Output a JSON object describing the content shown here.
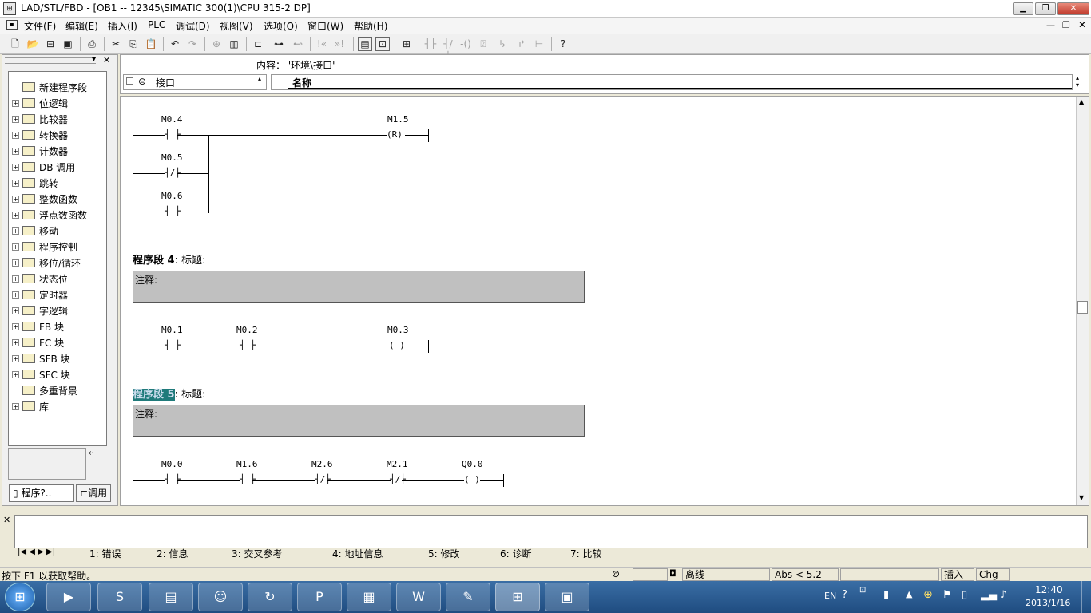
{
  "window": {
    "title": "LAD/STL/FBD  - [OB1 -- 12345\\SIMATIC 300(1)\\CPU 315-2 DP]"
  },
  "menu": [
    "文件(F)",
    "编辑(E)",
    "插入(I)",
    "PLC",
    "调试(D)",
    "视图(V)",
    "选项(O)",
    "窗口(W)",
    "帮助(H)"
  ],
  "tree": [
    {
      "label": "新建程序段",
      "icon": "new-network-icon",
      "expand": false
    },
    {
      "label": "位逻辑",
      "icon": "bit-logic-icon",
      "expand": true
    },
    {
      "label": "比较器",
      "icon": "comparator-icon",
      "expand": true
    },
    {
      "label": "转换器",
      "icon": "converter-icon",
      "expand": true
    },
    {
      "label": "计数器",
      "icon": "counter-icon",
      "expand": true
    },
    {
      "label": "DB 调用",
      "icon": "db-call-icon",
      "expand": true
    },
    {
      "label": "跳转",
      "icon": "jump-icon",
      "expand": true
    },
    {
      "label": "整数函数",
      "icon": "integer-function-icon",
      "expand": true
    },
    {
      "label": "浮点数函数",
      "icon": "float-function-icon",
      "expand": true
    },
    {
      "label": "移动",
      "icon": "move-icon",
      "expand": true
    },
    {
      "label": "程序控制",
      "icon": "program-control-icon",
      "expand": true
    },
    {
      "label": "移位/循环",
      "icon": "shift-rotate-icon",
      "expand": true
    },
    {
      "label": "状态位",
      "icon": "status-bit-icon",
      "expand": true
    },
    {
      "label": "定时器",
      "icon": "timer-icon",
      "expand": true
    },
    {
      "label": "字逻辑",
      "icon": "word-logic-icon",
      "expand": true
    },
    {
      "label": "FB 块",
      "icon": "fb-block-icon",
      "expand": true
    },
    {
      "label": "FC 块",
      "icon": "fc-block-icon",
      "expand": true
    },
    {
      "label": "SFB 块",
      "icon": "sfb-block-icon",
      "expand": true
    },
    {
      "label": "SFC 块",
      "icon": "sfc-block-icon",
      "expand": true
    },
    {
      "label": "多重背景",
      "icon": "multi-instance-icon",
      "expand": false
    },
    {
      "label": "库",
      "icon": "library-icon",
      "expand": true
    }
  ],
  "left_tabs": [
    "程序?..",
    "调用"
  ],
  "interface": {
    "content_label": "内容： '环境\\接口'",
    "node": "接口",
    "column_name": "名称"
  },
  "network3": {
    "contacts": [
      "M0.4",
      "M0.5",
      "M0.6"
    ],
    "coil": "M1.5",
    "coil_symbol": "(R)"
  },
  "network4": {
    "title_prefix": "程序段 4",
    "title_suffix": ": 标题:",
    "comment": "注释:",
    "contacts": [
      "M0.1",
      "M0.2"
    ],
    "coil": "M0.3",
    "coil_symbol": "( )"
  },
  "network5": {
    "title_prefix": "程序段 5",
    "title_suffix": ": 标题:",
    "comment": "注释:",
    "contacts": [
      "M0.0",
      "M1.6",
      "M2.6",
      "M2.1"
    ],
    "coil": "Q0.0",
    "coil_symbol": "( )"
  },
  "bottom_tabs": [
    "1: 错误",
    "2: 信息",
    "3: 交叉参考",
    "4: 地址信息",
    "5: 修改",
    "6: 诊断",
    "7: 比较"
  ],
  "status": {
    "help": "按下 F1 以获取帮助。",
    "mode": "离线",
    "abs": "Abs < 5.2",
    "insert": "插入",
    "chg": "Chg"
  },
  "taskbar": {
    "lang": "EN",
    "time": "12:40",
    "date": "2013/1/16"
  },
  "colors": {
    "taskbar": "#2b5d93",
    "comment_bg": "#c0c0c0",
    "highlight": "#1f7a7a"
  }
}
